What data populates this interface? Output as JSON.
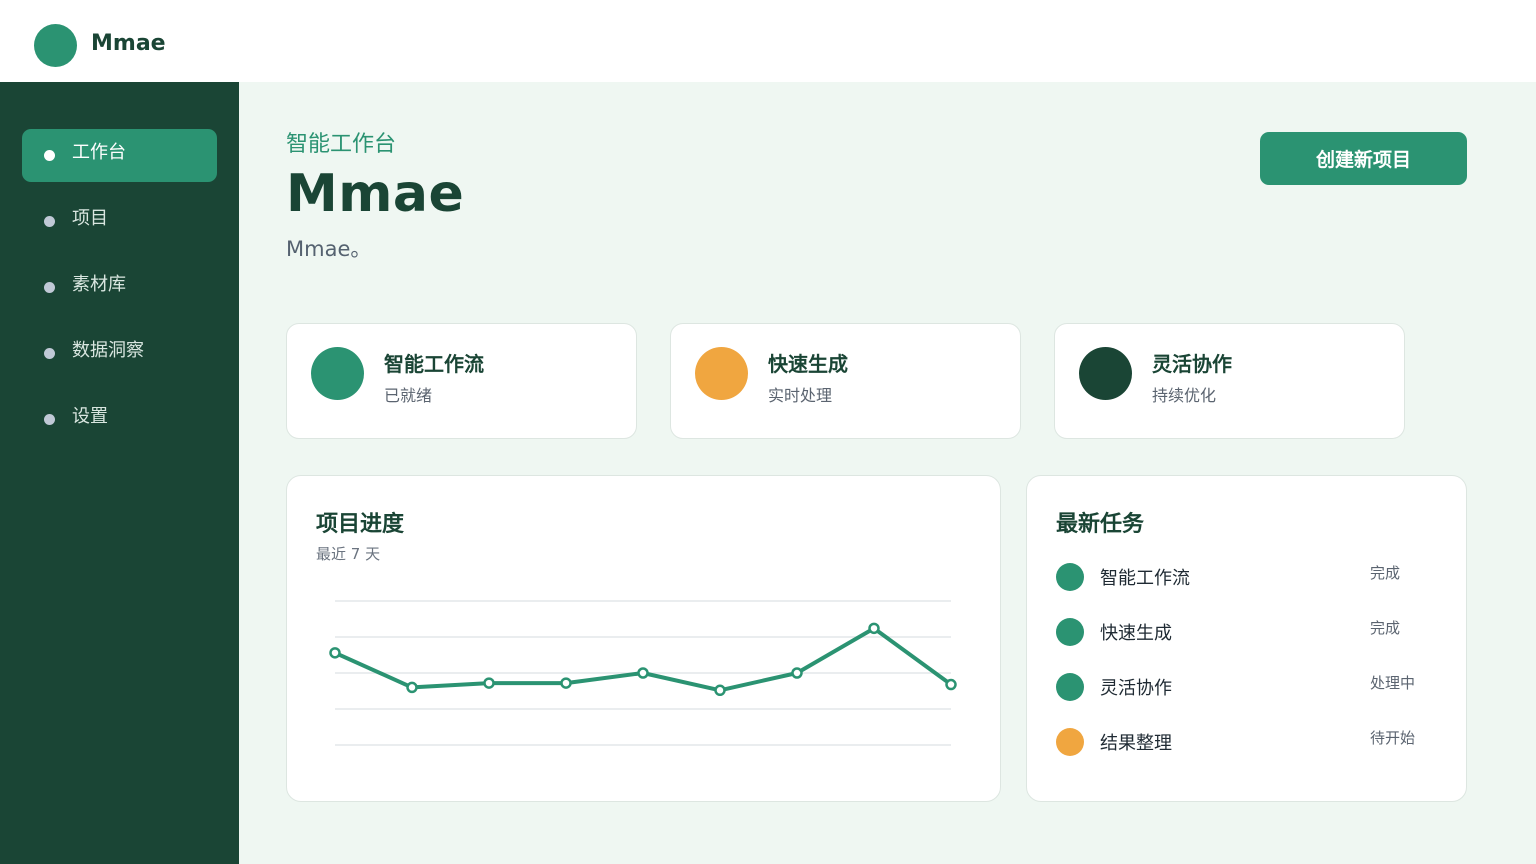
{
  "app": {
    "brand": "Mmae"
  },
  "sidebar": {
    "items": [
      {
        "label": "工作台",
        "active": true
      },
      {
        "label": "项目",
        "active": false
      },
      {
        "label": "素材库",
        "active": false
      },
      {
        "label": "数据洞察",
        "active": false
      },
      {
        "label": "设置",
        "active": false
      }
    ]
  },
  "hero": {
    "eyebrow": "智能工作台",
    "title": "Mmae",
    "subtitle": "Mmae。",
    "cta_label": "创建新项目"
  },
  "features": [
    {
      "title": "智能工作流",
      "subtitle": "已就绪",
      "color": "#2b9372"
    },
    {
      "title": "快速生成",
      "subtitle": "实时处理",
      "color": "#f0a640"
    },
    {
      "title": "灵活协作",
      "subtitle": "持续优化",
      "color": "#1a4535"
    }
  ],
  "progress_card": {
    "title": "项目进度",
    "subtitle": "最近 7 天"
  },
  "chart_data": {
    "type": "line",
    "title": "项目进度",
    "subtitle": "最近 7 天",
    "x": [
      1,
      2,
      3,
      4,
      5,
      6,
      7,
      8,
      9
    ],
    "series": [
      {
        "values": [
          64,
          40,
          43,
          43,
          50,
          38,
          50,
          81,
          42
        ]
      }
    ],
    "ylim": [
      0,
      100
    ],
    "grid": true,
    "color": "#2b9372"
  },
  "tasks_card": {
    "title": "最新任务",
    "items": [
      {
        "label": "智能工作流",
        "status": "完成",
        "color": "#2b9372"
      },
      {
        "label": "快速生成",
        "status": "完成",
        "color": "#2b9372"
      },
      {
        "label": "灵活协作",
        "status": "处理中",
        "color": "#2b9372"
      },
      {
        "label": "结果整理",
        "status": "待开始",
        "color": "#f0a640"
      }
    ]
  },
  "colors": {
    "primary": "#2b9372",
    "dark": "#1a4535",
    "accent": "#f0a640",
    "background": "#eff7f2"
  }
}
